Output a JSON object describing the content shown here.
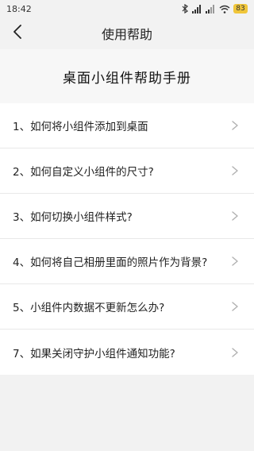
{
  "status_bar": {
    "time": "18:42",
    "battery": "83",
    "icons": [
      "bluetooth-icon",
      "signal-icon",
      "signal-icon",
      "wifi-icon",
      "battery-icon"
    ]
  },
  "header": {
    "back_icon": "chevron-left-icon",
    "title": "使用帮助"
  },
  "manual": {
    "title": "桌面小组件帮助手册"
  },
  "items": [
    {
      "label": "1、如何将小组件添加到桌面",
      "icon": "chevron-right-icon"
    },
    {
      "label": "2、如何自定义小组件的尺寸?",
      "icon": "chevron-right-icon"
    },
    {
      "label": "3、如何切换小组件样式?",
      "icon": "chevron-right-icon"
    },
    {
      "label": "4、如何将自己相册里面的照片作为背景?",
      "icon": "chevron-right-icon"
    },
    {
      "label": "5、小组件内数据不更新怎么办?",
      "icon": "chevron-right-icon"
    },
    {
      "label": "7、如果关闭守护小组件通知功能?",
      "icon": "chevron-right-icon"
    }
  ],
  "colors": {
    "background": "#f2f2f2",
    "list_background": "#ffffff",
    "battery": "#f0c63a",
    "chevron": "#b0b0b0"
  }
}
